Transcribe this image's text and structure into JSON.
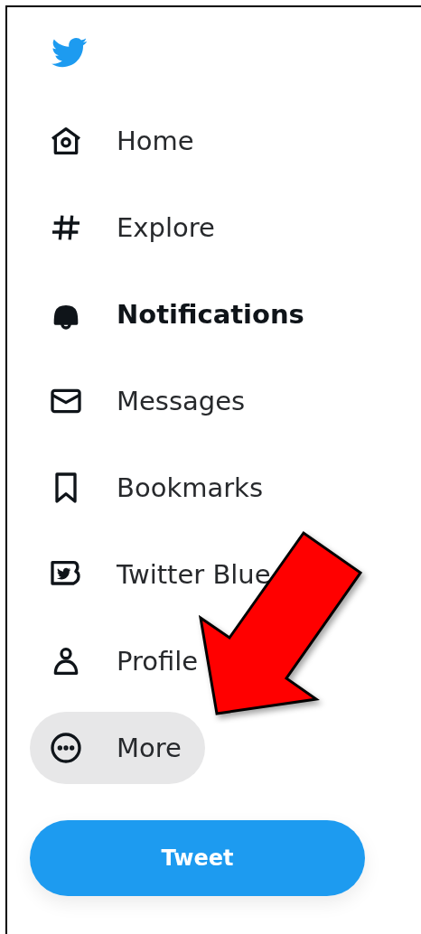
{
  "nav": [
    {
      "kind": "home",
      "label": "Home",
      "selected": false,
      "highlighted": false
    },
    {
      "kind": "explore",
      "label": "Explore",
      "selected": false,
      "highlighted": false
    },
    {
      "kind": "notifications",
      "label": "Notifications",
      "selected": true,
      "highlighted": false
    },
    {
      "kind": "messages",
      "label": "Messages",
      "selected": false,
      "highlighted": false
    },
    {
      "kind": "bookmarks",
      "label": "Bookmarks",
      "selected": false,
      "highlighted": false
    },
    {
      "kind": "blue",
      "label": "Twitter Blue",
      "selected": false,
      "highlighted": false
    },
    {
      "kind": "profile",
      "label": "Profile",
      "selected": false,
      "highlighted": false
    },
    {
      "kind": "more",
      "label": "More",
      "selected": false,
      "highlighted": true
    }
  ],
  "tweet_button": {
    "label": "Tweet"
  }
}
